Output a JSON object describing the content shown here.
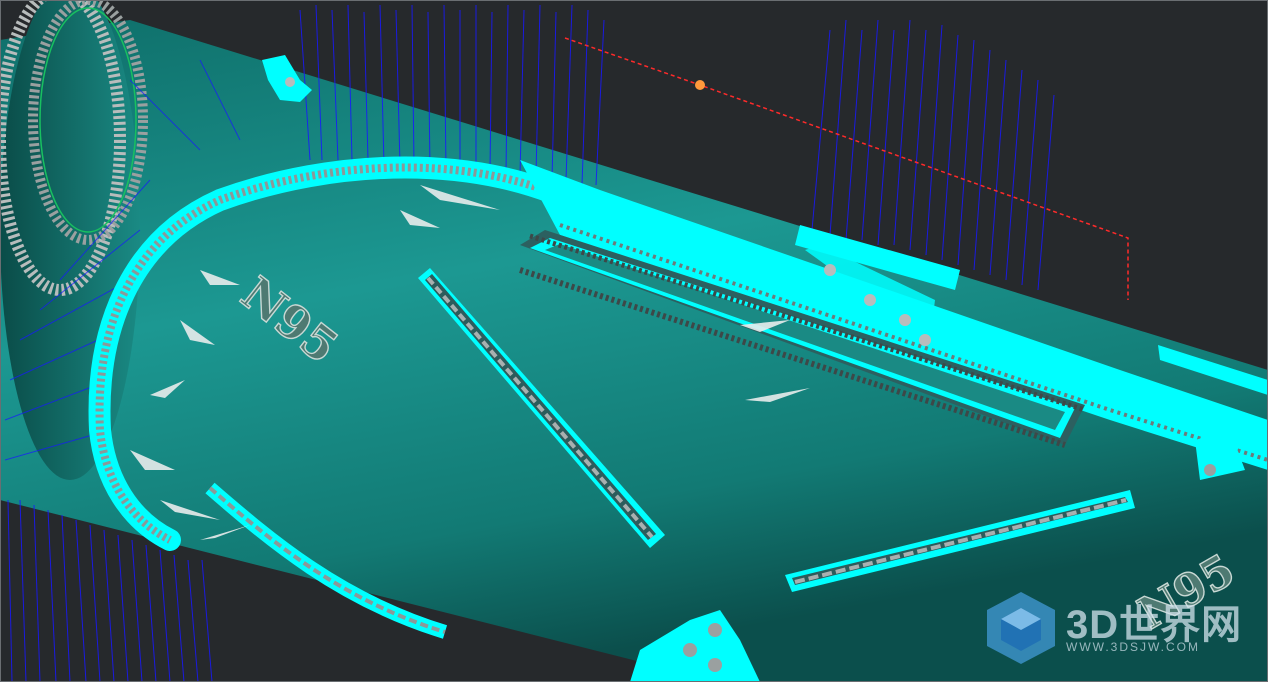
{
  "model": {
    "label_1": "N95",
    "label_2": "N95"
  },
  "watermark": {
    "brand": "3D世界网",
    "url": "WWW.3DSJW.COM"
  },
  "colors": {
    "background": "#26292c",
    "tube_body": "#1a8a84",
    "flex_cyan": "#00ffff",
    "wire_blue": "#1818ff",
    "gear_metal": "#b8bcbc",
    "measure_line": "#ff2a2a",
    "measure_point": "#ff9a3c"
  },
  "icons": {
    "watermark_logo": "cube-logo-icon"
  }
}
